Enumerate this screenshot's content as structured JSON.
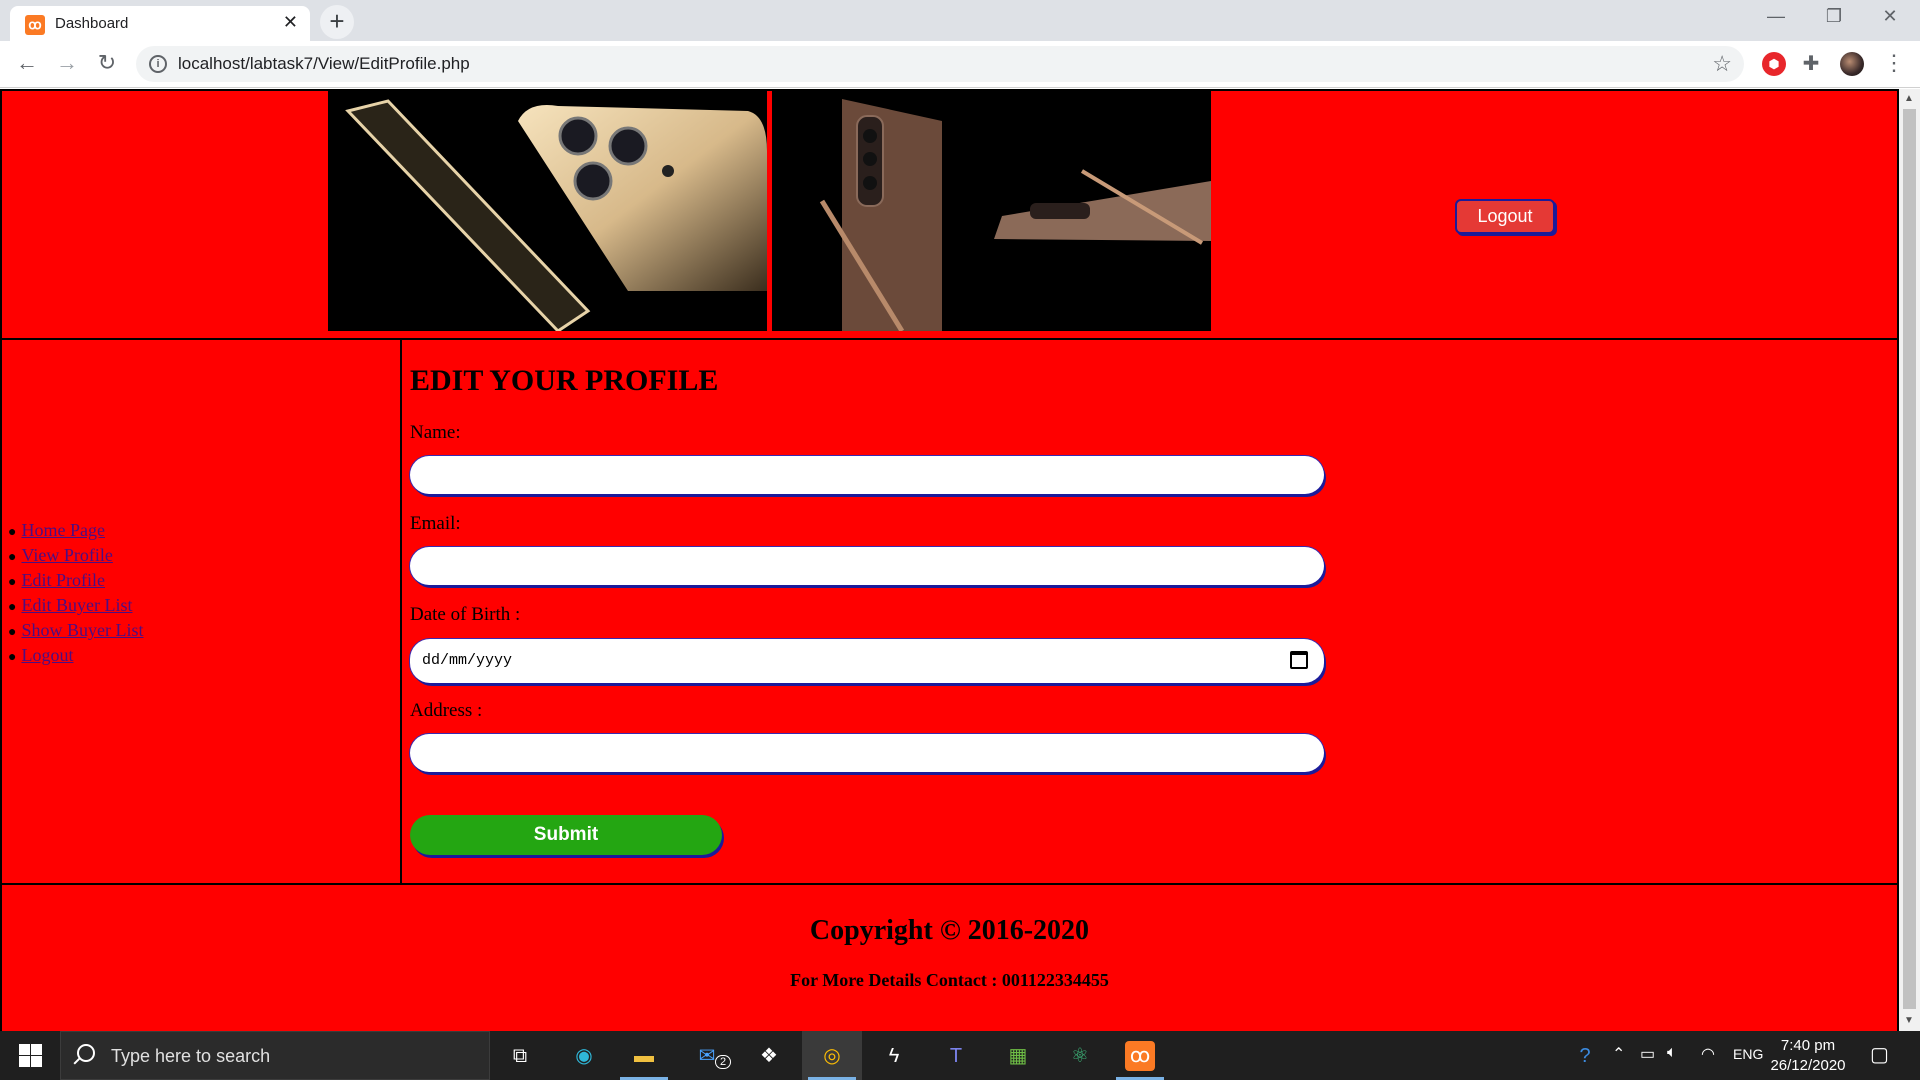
{
  "browser": {
    "tab_title": "Dashboard",
    "url": "localhost/labtask7/View/EditProfile.php",
    "window_controls": [
      "—",
      "❐",
      "✕"
    ]
  },
  "header": {
    "logout_label": "Logout"
  },
  "sidebar": {
    "items": [
      {
        "label": "Home Page"
      },
      {
        "label": "View Profile"
      },
      {
        "label": "Edit Profile"
      },
      {
        "label": "Edit Buyer List"
      },
      {
        "label": "Show Buyer List"
      },
      {
        "label": "Logout"
      }
    ]
  },
  "form": {
    "title": "EDIT YOUR PROFILE",
    "name_label": "Name:",
    "name_value": "",
    "email_label": "Email:",
    "email_value": "",
    "dob_label": "Date of Birth :",
    "dob_placeholder": "dd/mm/yyyy",
    "address_label": "Address :",
    "address_value": "",
    "submit_label": "Submit"
  },
  "footer": {
    "copyright": "Copyright © 2016-2020",
    "contact": "For More Details Contact : 001122334455"
  },
  "taskbar": {
    "search_placeholder": "Type here to search",
    "mail_badge": "2",
    "language": "ENG",
    "time": "7:40 pm",
    "date": "26/12/2020"
  },
  "colors": {
    "page_background": "#ff0000",
    "logout_button": "#e53935",
    "submit_button": "#24a612",
    "link_color": "#4b0e83"
  }
}
